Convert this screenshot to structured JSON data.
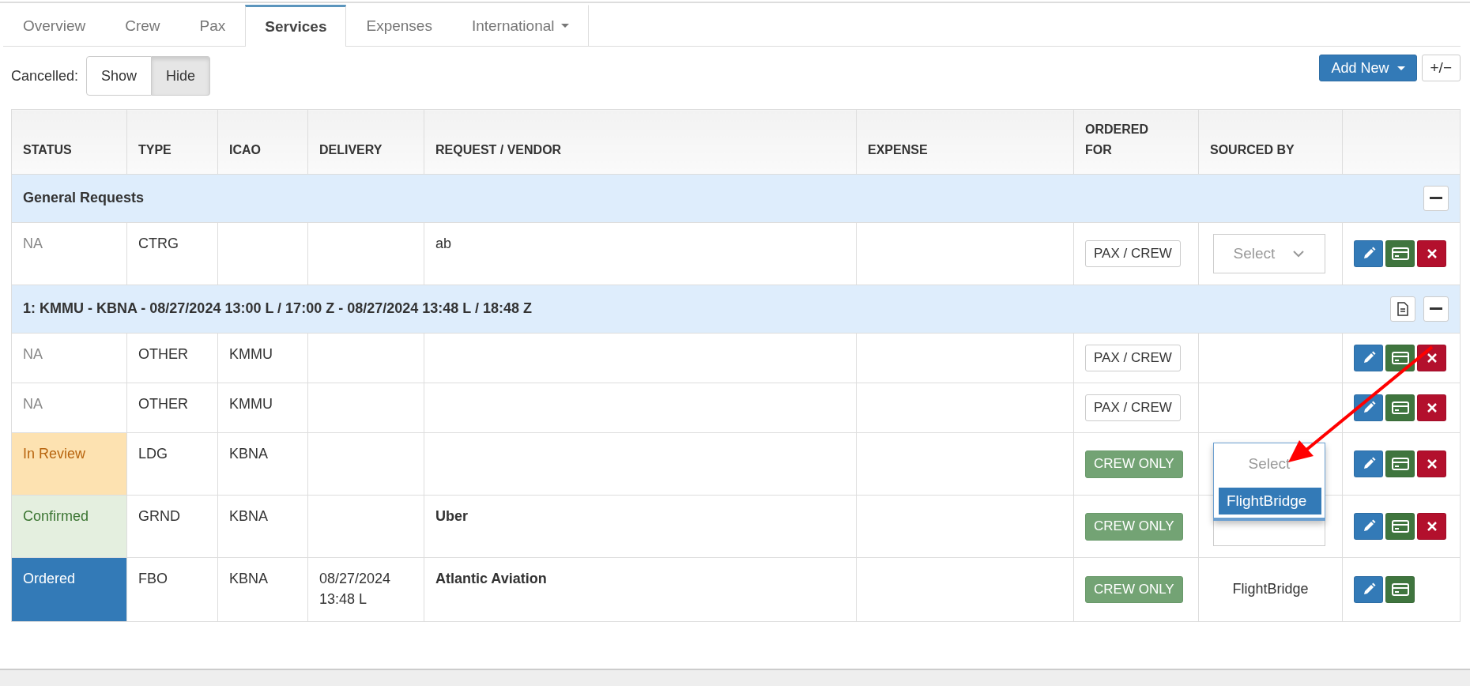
{
  "tabs": [
    {
      "label": "Overview",
      "selected": false,
      "dropdown": false
    },
    {
      "label": "Crew",
      "selected": false,
      "dropdown": false
    },
    {
      "label": "Pax",
      "selected": false,
      "dropdown": false
    },
    {
      "label": "Services",
      "selected": true,
      "dropdown": false
    },
    {
      "label": "Expenses",
      "selected": false,
      "dropdown": false
    },
    {
      "label": "International",
      "selected": false,
      "dropdown": true
    }
  ],
  "cancelled_filter": {
    "label": "Cancelled:",
    "options": [
      {
        "label": "Show",
        "selected": false
      },
      {
        "label": "Hide",
        "selected": true
      }
    ]
  },
  "toolbar": {
    "add_button": "Add New",
    "toggle_button": "+/−"
  },
  "table": {
    "columns": [
      "STATUS",
      "TYPE",
      "ICAO",
      "DELIVERY",
      "REQUEST / VENDOR",
      "EXPENSE",
      "ORDERED FOR",
      "SOURCED BY"
    ],
    "groups": [
      {
        "title": "General Requests",
        "document_button": false,
        "rows": [
          {
            "status": {
              "text": "NA",
              "kind": "none"
            },
            "type": "CTRG",
            "icao": "",
            "delivery": "",
            "request": {
              "text": "ab",
              "bold": false
            },
            "ordered_for": {
              "text": "PAX / CREW",
              "kind": "outline"
            },
            "sourced_by": {
              "kind": "select",
              "placeholder": "Select"
            },
            "actions": [
              {
                "kind": "edit"
              },
              {
                "kind": "card"
              },
              {
                "kind": "delete"
              }
            ]
          }
        ]
      },
      {
        "title": "1: KMMU - KBNA - 08/27/2024 13:00 L / 17:00 Z - 08/27/2024 13:48 L / 18:48 Z",
        "document_button": true,
        "rows": [
          {
            "status": {
              "text": "NA",
              "kind": "none"
            },
            "type": "OTHER",
            "icao": "KMMU",
            "delivery": "",
            "ordered_for": {
              "text": "PAX / CREW",
              "kind": "outline"
            },
            "sourced_by": {
              "kind": "none"
            },
            "actions": [
              {
                "kind": "edit"
              },
              {
                "kind": "card"
              },
              {
                "kind": "delete"
              }
            ]
          },
          {
            "status": {
              "text": "NA",
              "kind": "none"
            },
            "type": "OTHER",
            "icao": "KMMU",
            "delivery": "",
            "ordered_for": {
              "text": "PAX / CREW",
              "kind": "outline"
            },
            "sourced_by": {
              "kind": "none"
            },
            "actions": [
              {
                "kind": "edit"
              },
              {
                "kind": "card"
              },
              {
                "kind": "delete"
              }
            ]
          },
          {
            "status": {
              "text": "In Review",
              "kind": "review"
            },
            "type": "LDG",
            "icao": "KBNA",
            "delivery": "",
            "ordered_for": {
              "text": "CREW ONLY",
              "kind": "solid"
            },
            "sourced_by": {
              "kind": "open",
              "placeholder": "Select",
              "options": [
                {
                  "label": "FlightBridge",
                  "selected": true
                }
              ]
            },
            "actions": [
              {
                "kind": "edit"
              },
              {
                "kind": "card"
              },
              {
                "kind": "delete"
              }
            ]
          },
          {
            "status": {
              "text": "Confirmed",
              "kind": "confirmed"
            },
            "type": "GRND",
            "icao": "KBNA",
            "delivery": "",
            "request": {
              "text": "Uber",
              "bold": true
            },
            "ordered_for": {
              "text": "CREW ONLY",
              "kind": "solid"
            },
            "sourced_by": {
              "kind": "select"
            },
            "actions": [
              {
                "kind": "edit"
              },
              {
                "kind": "card"
              },
              {
                "kind": "delete"
              }
            ]
          },
          {
            "status": {
              "text": "Ordered",
              "kind": "ordered"
            },
            "type": "FBO",
            "icao": "KBNA",
            "delivery": "08/27/2024\n13:48 L",
            "request": {
              "text": "Atlantic Aviation",
              "bold": true
            },
            "ordered_for": {
              "text": "CREW ONLY",
              "kind": "solid"
            },
            "sourced_by": {
              "kind": "text",
              "text": "FlightBridge"
            },
            "actions": [
              {
                "kind": "edit"
              },
              {
                "kind": "card"
              }
            ]
          }
        ]
      }
    ]
  }
}
